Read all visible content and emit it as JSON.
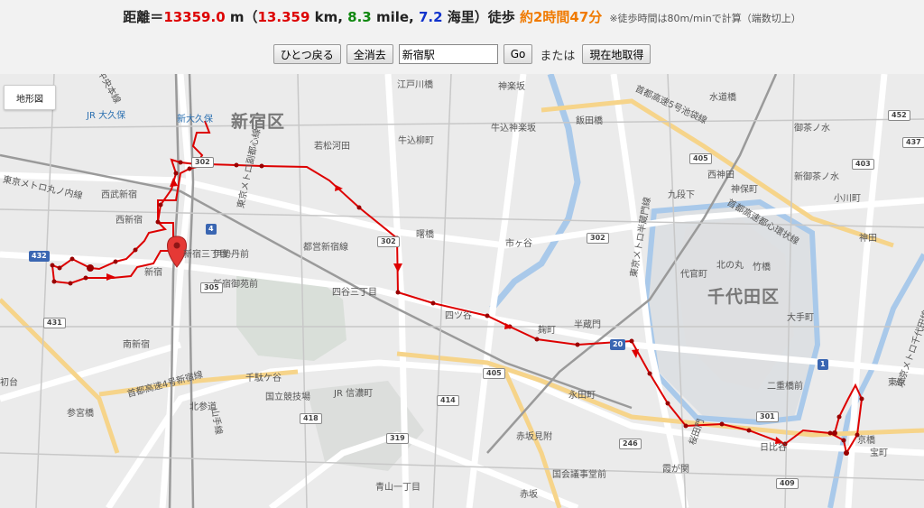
{
  "distance": {
    "label": "距離＝",
    "meters": "13359.0",
    "m_unit": " m（",
    "km": "13.359",
    "km_unit": " km, ",
    "mile": "8.3",
    "mile_unit": " mile, ",
    "nm": "7.2",
    "nm_unit": " 海里）",
    "walk_label": "徒歩 ",
    "walk_time": "約2時間47分",
    "note": "※徒歩時間は80m/minで計算（端数切上）"
  },
  "controls": {
    "undo_label": "ひとつ戻る",
    "clear_label": "全消去",
    "search_value": "新宿駅",
    "go_label": "Go",
    "or_text": "または",
    "current_location_label": "現在地取得"
  },
  "map": {
    "terrain_label": "地形図",
    "wards": [
      "新宿区",
      "千代田区"
    ],
    "places": [
      "JR 大久保",
      "新大久保",
      "中央本線",
      "東京メトロ丸ノ内線",
      "西武新宿",
      "西新宿",
      "新宿",
      "新宿三丁目",
      "伊勢丹前",
      "新宿御苑前",
      "南新宿",
      "初台",
      "参宮橋",
      "北参道",
      "千駄ケ谷",
      "国立競技場",
      "JR 信濃町",
      "山手線",
      "首都高速4号新宿線",
      "若松河田",
      "牛込柳町",
      "曙橋",
      "都営新宿線",
      "四谷三丁目",
      "四ツ谷",
      "市ヶ谷",
      "麹町",
      "半蔵門",
      "永田町",
      "赤坂見附",
      "国会議事堂前",
      "青山一丁目",
      "赤坂",
      "霞が関",
      "桜田門",
      "日比谷",
      "二重橋前",
      "東京",
      "京橋",
      "大手町",
      "神田",
      "竹橋",
      "九段下",
      "神保町",
      "水道橋",
      "飯田橋",
      "牛込神楽坂",
      "神楽坂",
      "御茶ノ水",
      "新御茶ノ水",
      "小川町",
      "代官町",
      "北の丸",
      "東京メトロ半蔵門線",
      "首都高速5号池袋線",
      "首都高速都心環状線",
      "西神田",
      "宝町",
      "東京メトロ副都心線",
      "江戸川橋",
      "東京メトロ千代田線"
    ],
    "route_numbers": [
      "302",
      "432",
      "431",
      "305",
      "4",
      "414",
      "418",
      "319",
      "405",
      "246",
      "301",
      "409",
      "20",
      "1",
      "405",
      "452",
      "437",
      "403",
      "302",
      "302"
    ]
  },
  "colors": {
    "route": "#dd0000",
    "accent_red": "#dd0000",
    "accent_green": "#118811",
    "accent_blue": "#1133cc",
    "accent_orange": "#f07a00"
  }
}
